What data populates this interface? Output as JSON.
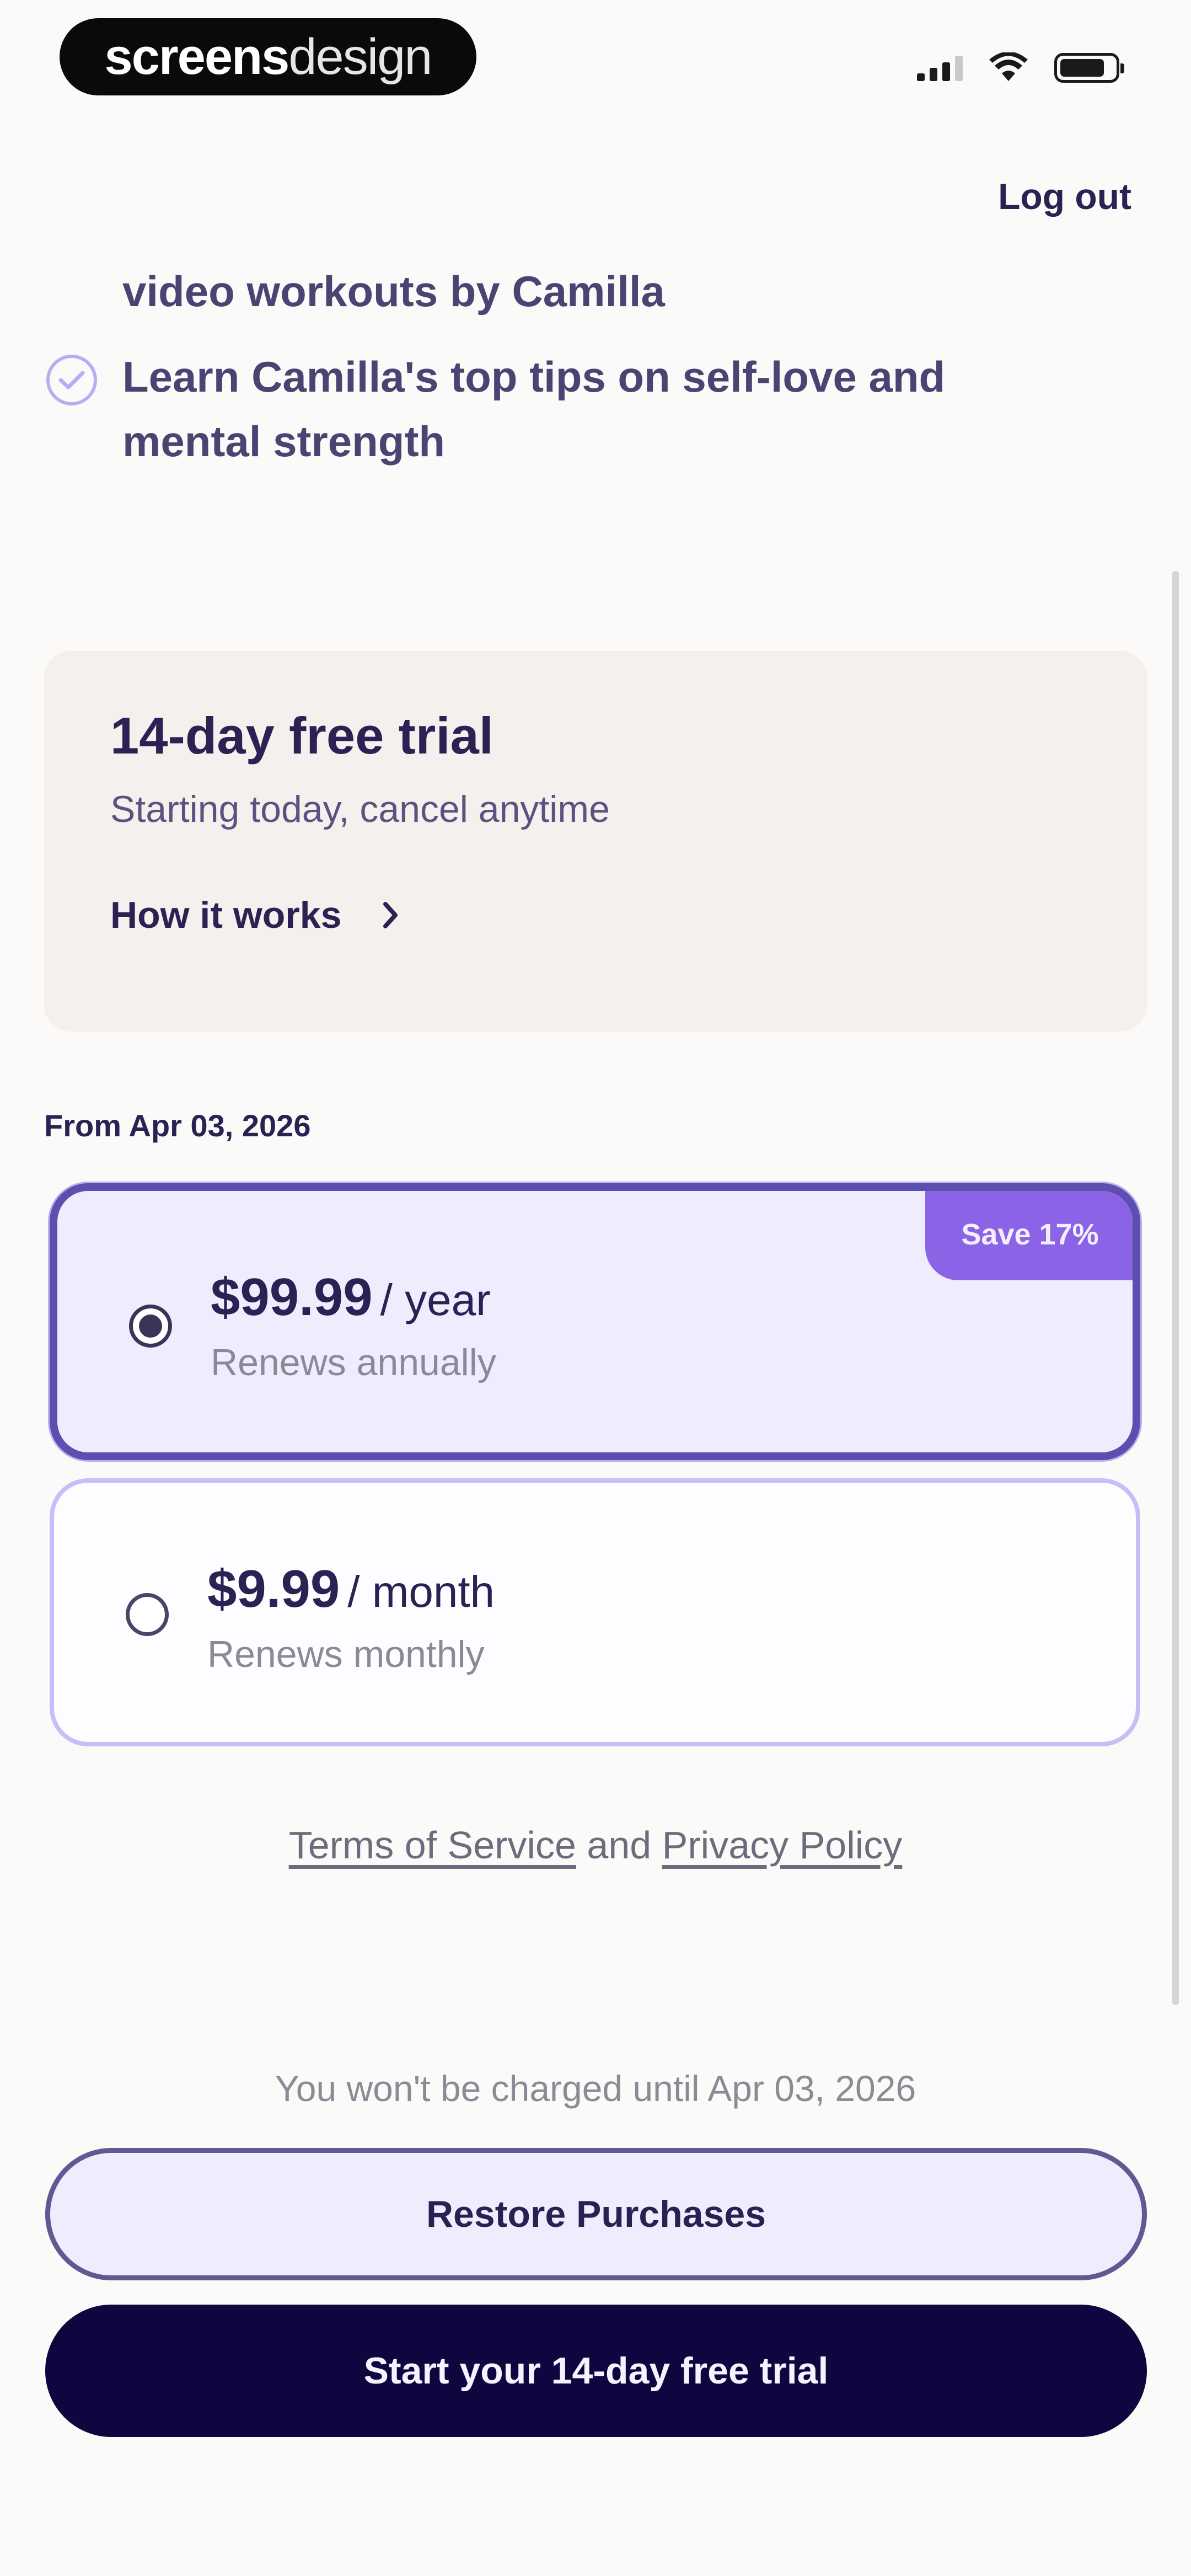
{
  "status_bar": {
    "brand_bold": "screens",
    "brand_light": "design",
    "icons": [
      "signal-icon",
      "wifi-icon",
      "battery-icon"
    ]
  },
  "header": {
    "logout_label": "Log out"
  },
  "features": {
    "continued_text": "video workouts by Camilla",
    "items": [
      {
        "icon": "check-circle-icon",
        "text": "Learn Camilla's top tips on self-love and mental strength"
      }
    ]
  },
  "trial_card": {
    "title": "14-day free trial",
    "subtitle": "Starting today, cancel anytime",
    "how_it_works": "How it works"
  },
  "plans": {
    "from_date": "From Apr 03, 2026",
    "yearly": {
      "price": "$99.99",
      "period": "/ year",
      "renews": "Renews annually",
      "badge": "Save 17%",
      "selected": true
    },
    "monthly": {
      "price": "$9.99",
      "period": "/ month",
      "renews": "Renews monthly",
      "selected": false
    }
  },
  "legal": {
    "terms": "Terms of Service",
    "and": "and",
    "privacy": "Privacy Policy"
  },
  "notice": "You won't be charged until Apr 03, 2026",
  "buttons": {
    "restore": "Restore Purchases",
    "start_trial": "Start your 14-day free trial"
  },
  "colors": {
    "primary_dark": "#110540",
    "accent_purple": "#8b63e6",
    "selected_border": "#5d4fb0",
    "text_dark": "#2b2253"
  }
}
